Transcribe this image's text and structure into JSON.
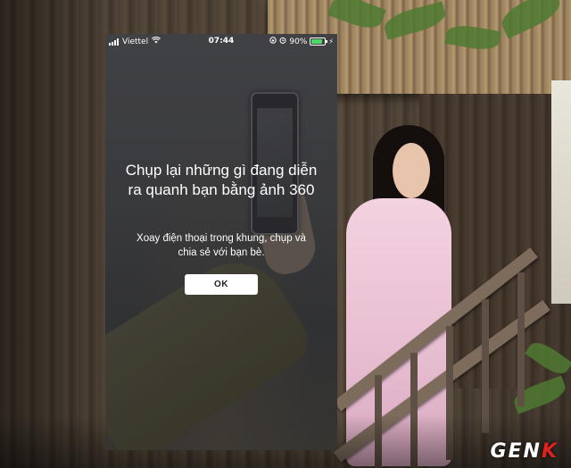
{
  "status_bar": {
    "carrier": "Viettel",
    "time": "07:44",
    "battery_percent": "90%",
    "battery_level": 0.9,
    "icons": [
      "signal-bars-icon",
      "wifi-icon",
      "orientation-lock-icon",
      "alarm-icon",
      "battery-icon",
      "charging-bolt-icon"
    ]
  },
  "dialog": {
    "headline": "Chụp lại những gì đang diễn ra quanh bạn bằng ảnh 360",
    "subtitle": "Xoay điện thoại trong khung, chụp và chia sẻ với bạn bè.",
    "ok_label": "OK"
  },
  "watermark": {
    "text_main": "GEN",
    "text_accent": "K",
    "accent_color": "#e0231f"
  },
  "colors": {
    "battery_green": "#4cd964",
    "button_bg": "#ffffff",
    "text": "#ffffff"
  }
}
